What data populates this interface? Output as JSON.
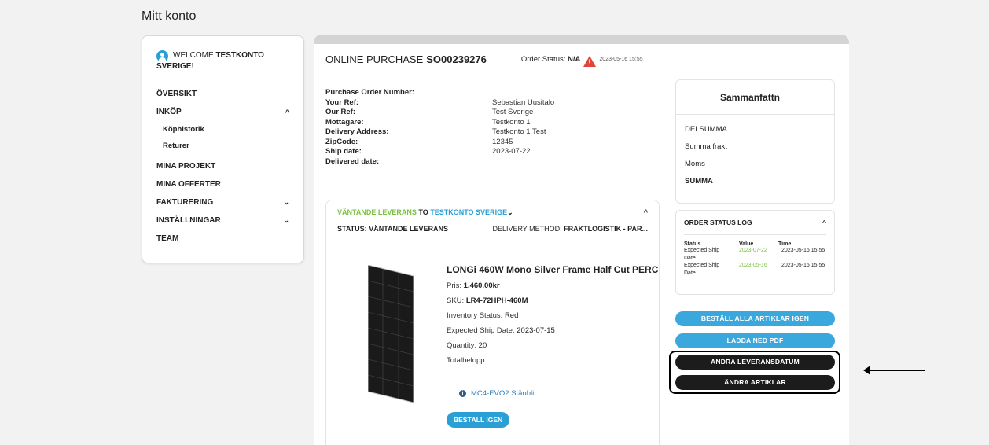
{
  "page_title": "Mitt konto",
  "sidebar": {
    "welcome_prefix": "WELCOME",
    "welcome_name": "TESTKONTO",
    "welcome_name_line2": "SVERIGE!",
    "items": [
      {
        "label": "ÖVERSIKT"
      },
      {
        "label": "INKÖP",
        "chevron": "^"
      },
      {
        "label": "Köphistorik"
      },
      {
        "label": "Returer"
      },
      {
        "label": "MINA PROJEKT"
      },
      {
        "label": "MINA OFFERTER"
      },
      {
        "label": "FAKTURERING",
        "chevron": "⌄"
      },
      {
        "label": "INSTÄLLNINGAR",
        "chevron": "⌄"
      },
      {
        "label": "TEAM"
      }
    ]
  },
  "order": {
    "label": "ONLINE PURCHASE",
    "number": "SO00239276",
    "status_label": "Order Status:",
    "status_value": "N/A",
    "date": "2023-05-16 15:55",
    "details": [
      {
        "k": "Purchase Order Number:",
        "v": ""
      },
      {
        "k": "Your Ref:",
        "v": "Sebastian Uusitalo"
      },
      {
        "k": "Our Ref:",
        "v": "Test Sverige"
      },
      {
        "k": "Mottagare:",
        "v": "Testkonto 1"
      },
      {
        "k": "Delivery Address:",
        "v": "Testkonto 1 Test"
      },
      {
        "k": "ZipCode:",
        "v": "12345"
      },
      {
        "k": "Ship date:",
        "v": "2023-07-22"
      },
      {
        "k": "Delivered date:",
        "v": ""
      }
    ]
  },
  "delivery": {
    "status_word": "VÄNTANDE LEVERANS",
    "to": "TO",
    "recipient": "TESTKONTO SVERIGE",
    "status_label": "STATUS:",
    "status_value": "VÄNTANDE LEVERANS",
    "method_label": "DELIVERY METHOD:",
    "method_value": "FRAKTLOGISTIK - PAR...",
    "collapse_icon": "^"
  },
  "product": {
    "title": "LONGi 460W Mono Silver Frame Half Cut PERC",
    "price_label": "Pris:",
    "price": "1,460.00kr",
    "sku_label": "SKU:",
    "sku": "LR4-72HPH-460M",
    "inventory_label": "Inventory Status:",
    "inventory": "Red",
    "ship_label": "Expected Ship Date:",
    "ship": "2023-07-15",
    "qty_label": "Quantity:",
    "qty": "20",
    "total_label": "Totalbelopp:",
    "accessory": "MC4-EVO2 Stäubli",
    "reorder": "BESTÄLL IGEN"
  },
  "summary": {
    "title": "Sammanfattn",
    "subtotal": "DELSUMMA",
    "shipping": "Summa frakt",
    "tax": "Moms",
    "total": "SUMMA"
  },
  "status_log": {
    "title": "ORDER STATUS LOG",
    "headers": [
      "Status",
      "Value",
      "Time"
    ],
    "rows": [
      {
        "status": "Expected Ship Date",
        "value": "2023-07-22",
        "time": "2023-05-16 15:55"
      },
      {
        "status": "Expected Ship Date",
        "value": "2023-05-16",
        "time": "2023-05-16 15:55"
      }
    ]
  },
  "actions": {
    "reorder_all": "BESTÄLL ALLA ARTIKLAR IGEN",
    "download_pdf": "LADDA NED PDF",
    "change_delivery": "ÄNDRA LEVERANSDATUM",
    "change_items": "ÄNDRA ARTIKLAR"
  },
  "colors": {
    "accent_blue": "#2a9fd6",
    "accent_green": "#7ac143",
    "warning_red": "#e0443a",
    "dark_button": "#1c1c1c"
  }
}
